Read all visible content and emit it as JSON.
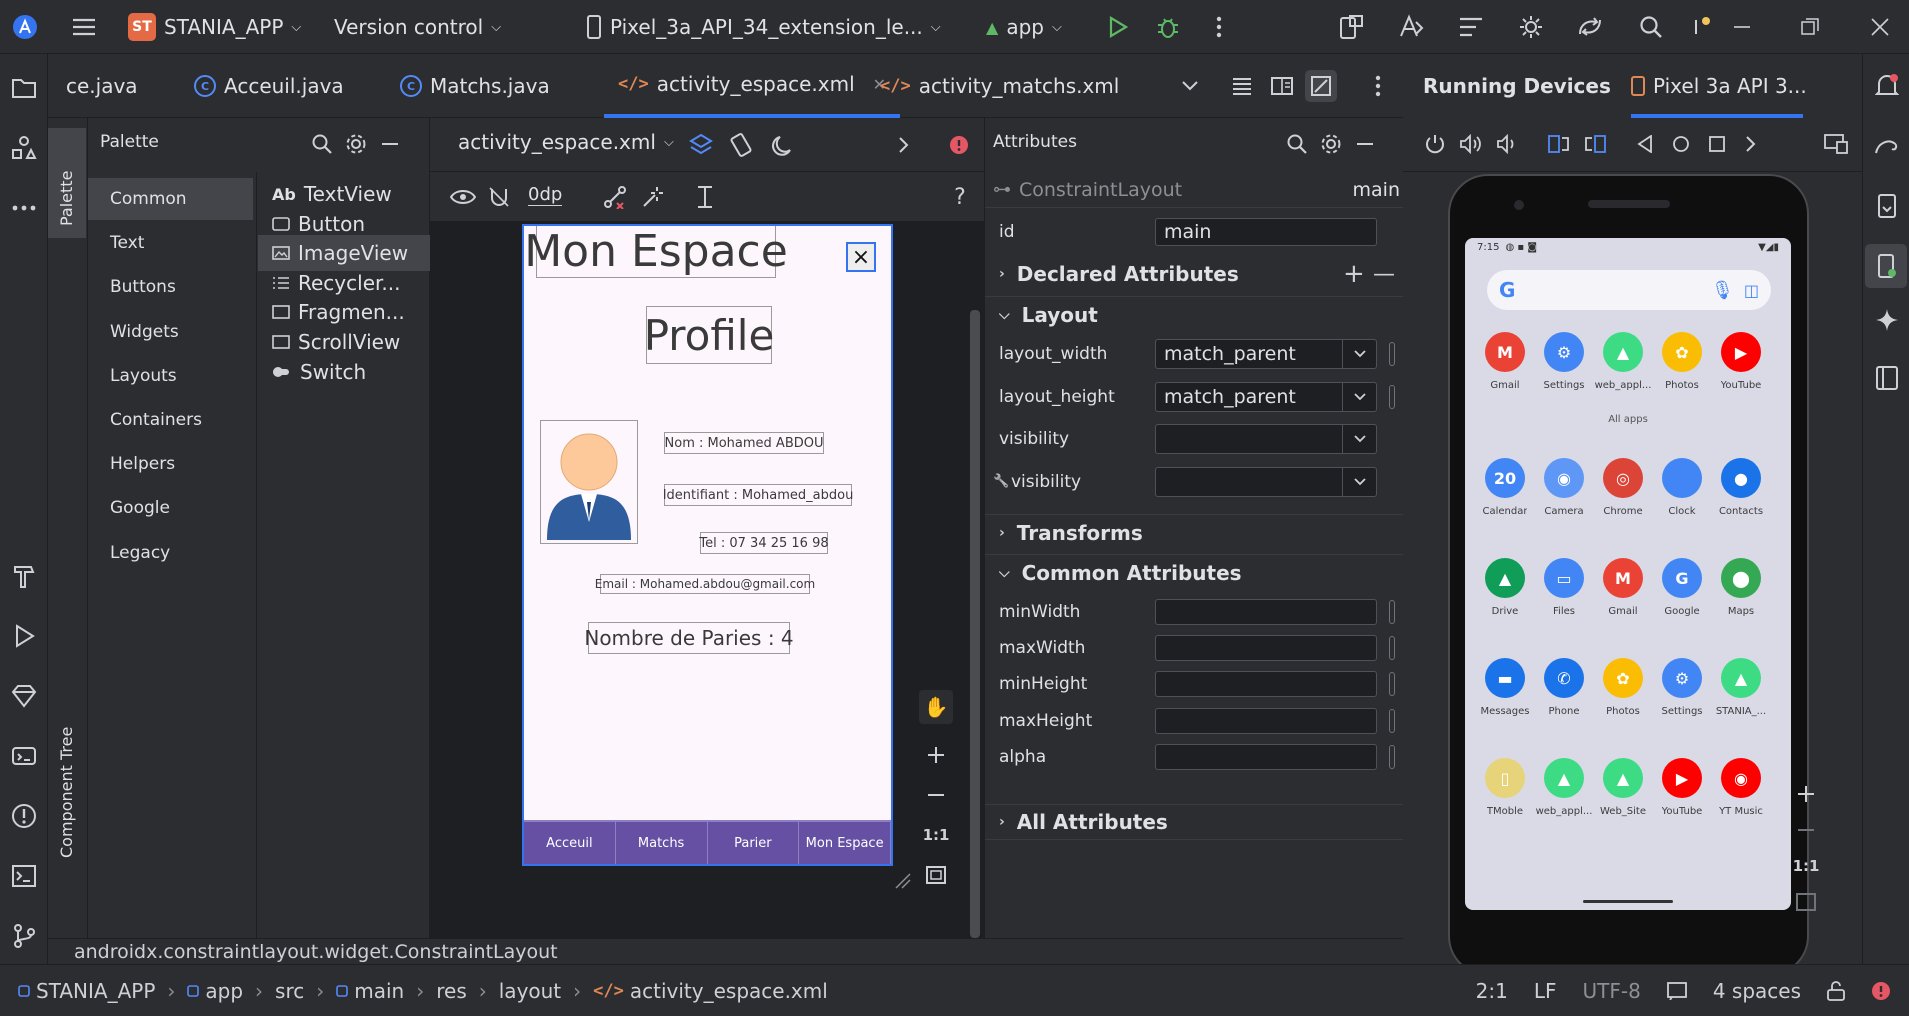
{
  "titlebar": {
    "project_badge": "ST",
    "project_name": "STANIA_APP",
    "vcs": "Version control",
    "device": "Pixel_3a_API_34_extension_le...",
    "run_config": "app"
  },
  "tabs": [
    {
      "label": "ce.java",
      "type": "java"
    },
    {
      "label": "Acceuil.java",
      "type": "java"
    },
    {
      "label": "Matchs.java",
      "type": "java"
    },
    {
      "label": "activity_espace.xml",
      "type": "xml",
      "active": true
    },
    {
      "label": "activity_matchs.xml",
      "type": "xml"
    }
  ],
  "palette": {
    "strip_label": "Palette",
    "tree_label": "Component Tree",
    "title": "Palette",
    "categories": [
      "Common",
      "Text",
      "Buttons",
      "Widgets",
      "Layouts",
      "Containers",
      "Helpers",
      "Google",
      "Legacy"
    ],
    "selected_category": "Common",
    "widgets": [
      {
        "icon": "Ab",
        "label": "TextView"
      },
      {
        "icon": "button-icon",
        "label": "Button"
      },
      {
        "icon": "image-icon",
        "label": "ImageView",
        "selected": true
      },
      {
        "icon": "list-icon",
        "label": "Recycler..."
      },
      {
        "icon": "fragment-icon",
        "label": "Fragmen..."
      },
      {
        "icon": "scroll-icon",
        "label": "ScrollView"
      },
      {
        "icon": "switch-icon",
        "label": "Switch"
      }
    ]
  },
  "design": {
    "file": "activity_espace.xml",
    "margin": "0dp",
    "zoom_label": "1:1"
  },
  "preview": {
    "title": "Mon Espace",
    "close": "×",
    "profile": "Profile",
    "nom": "Nom : Mohamed ABDOU",
    "identifiant": "Identifiant : Mohamed_abdou",
    "tel": "Tel : 07 34 25 16 98",
    "email": "Email : Mohamed.abdou@gmail.com",
    "paries": "Nombre de Paries : 4",
    "nav": [
      "Acceuil",
      "Matchs",
      "Parier",
      "Mon Espace"
    ]
  },
  "attributes": {
    "title": "Attributes",
    "component": "ConstraintLayout",
    "component_id": "main",
    "id_label": "id",
    "id_value": "main",
    "sections": {
      "declared": "Declared Attributes",
      "layout": "Layout",
      "transforms": "Transforms",
      "common": "Common Attributes",
      "all": "All Attributes"
    },
    "layout_rows": [
      {
        "label": "layout_width",
        "value": "match_parent"
      },
      {
        "label": "layout_height",
        "value": "match_parent"
      },
      {
        "label": "visibility",
        "value": ""
      },
      {
        "label": "visibility",
        "value": ""
      }
    ],
    "common_rows": [
      "minWidth",
      "maxWidth",
      "minHeight",
      "maxHeight",
      "alpha"
    ]
  },
  "running": {
    "title": "Running Devices",
    "device_tab": "Pixel 3a API 3...",
    "time": "7:15",
    "all_apps": "All apps",
    "zoom_label": "1:1",
    "apps_row1": [
      {
        "label": "Gmail",
        "color": "#ea4335",
        "glyph": "M"
      },
      {
        "label": "Settings",
        "color": "#4285f4",
        "glyph": "⚙"
      },
      {
        "label": "web_appl...",
        "color": "#3ddc84",
        "glyph": "▲"
      },
      {
        "label": "Photos",
        "color": "#fbbc04",
        "glyph": "✿"
      },
      {
        "label": "YouTube",
        "color": "#ff0000",
        "glyph": "▶"
      }
    ],
    "apps_grid": [
      [
        {
          "label": "Calendar",
          "color": "#4285f4",
          "glyph": "20"
        },
        {
          "label": "Camera",
          "color": "#5e97f6",
          "glyph": "◉"
        },
        {
          "label": "Chrome",
          "color": "#db4437",
          "glyph": "◎"
        },
        {
          "label": "Clock",
          "color": "#4285f4",
          "glyph": ""
        },
        {
          "label": "Contacts",
          "color": "#1a73e8",
          "glyph": "●"
        }
      ],
      [
        {
          "label": "Drive",
          "color": "#0f9d58",
          "glyph": "▲"
        },
        {
          "label": "Files",
          "color": "#4285f4",
          "glyph": "▭"
        },
        {
          "label": "Gmail",
          "color": "#ea4335",
          "glyph": "M"
        },
        {
          "label": "Google",
          "color": "#4285f4",
          "glyph": "G"
        },
        {
          "label": "Maps",
          "color": "#34a853",
          "glyph": "⬤"
        }
      ],
      [
        {
          "label": "Messages",
          "color": "#1a73e8",
          "glyph": "▬"
        },
        {
          "label": "Phone",
          "color": "#1a73e8",
          "glyph": "✆"
        },
        {
          "label": "Photos",
          "color": "#fbbc04",
          "glyph": "✿"
        },
        {
          "label": "Settings",
          "color": "#4285f4",
          "glyph": "⚙"
        },
        {
          "label": "STANIA_...",
          "color": "#3ddc84",
          "glyph": "▲"
        }
      ],
      [
        {
          "label": "TMoble",
          "color": "#e7d37a",
          "glyph": "▯"
        },
        {
          "label": "web_appl...",
          "color": "#3ddc84",
          "glyph": "▲"
        },
        {
          "label": "Web_Site",
          "color": "#3ddc84",
          "glyph": "▲"
        },
        {
          "label": "YouTube",
          "color": "#ff0000",
          "glyph": "▶"
        },
        {
          "label": "YT Music",
          "color": "#ff0000",
          "glyph": "◉"
        }
      ]
    ]
  },
  "status": {
    "component_path": "androidx.constraintlayout.widget.ConstraintLayout",
    "breadcrumbs": [
      "STANIA_APP",
      "app",
      "src",
      "main",
      "res",
      "layout",
      "activity_espace.xml"
    ],
    "position": "2:1",
    "line_sep": "LF",
    "encoding": "UTF-8",
    "indent": "4 spaces"
  },
  "colors": {
    "accent": "#3574f0",
    "nav_purple": "#6650a4",
    "run_green": "#5fb865",
    "error_red": "#e55765"
  }
}
